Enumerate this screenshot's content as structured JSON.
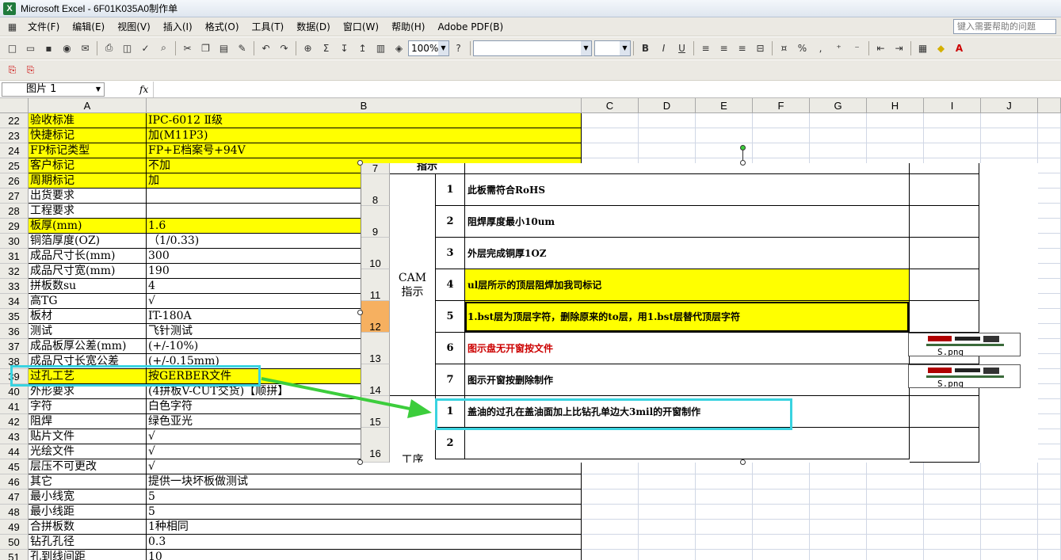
{
  "window": {
    "title": "Microsoft Excel - 6F01K035A0制作单",
    "app_icon": "X"
  },
  "menu": [
    "文件(F)",
    "编辑(E)",
    "视图(V)",
    "插入(I)",
    "格式(O)",
    "工具(T)",
    "数据(D)",
    "窗口(W)",
    "帮助(H)",
    "Adobe PDF(B)"
  ],
  "help_search": {
    "placeholder": "键入需要帮助的问题"
  },
  "toolbar": {
    "zoom": "100%"
  },
  "formula_bar": {
    "name_box": "图片 1",
    "fx": "fx",
    "formula": ""
  },
  "columns": [
    "A",
    "B",
    "C",
    "D",
    "E",
    "F",
    "G",
    "H",
    "I",
    "J"
  ],
  "rows": [
    {
      "num": "22",
      "a": "验收标准",
      "b": "IPC-6012 Ⅱ级",
      "yellow": true
    },
    {
      "num": "23",
      "a": "快捷标记",
      "b": "加(M11P3)",
      "yellow": true
    },
    {
      "num": "24",
      "a": "FP标记类型",
      "b": "FP+E档案号+94V",
      "yellow": true
    },
    {
      "num": "25",
      "a": "客户标记",
      "b": "不加",
      "yellow": true
    },
    {
      "num": "26",
      "a": "周期标记",
      "b": "加",
      "yellow": true
    },
    {
      "num": "27",
      "a": "出货要求",
      "b": "",
      "yellow": false
    },
    {
      "num": "28",
      "a": "工程要求",
      "b": "",
      "yellow": false
    },
    {
      "num": "29",
      "a": "板厚(mm)",
      "b": "1.6",
      "yellow": true
    },
    {
      "num": "30",
      "a": "铜箔厚度(OZ)",
      "b": "（1/0.33)",
      "yellow": false
    },
    {
      "num": "31",
      "a": "成品尺寸长(mm)",
      "b": "300",
      "yellow": false
    },
    {
      "num": "32",
      "a": "成品尺寸宽(mm)",
      "b": "190",
      "yellow": false
    },
    {
      "num": "33",
      "a": "拼板数su",
      "b": "4",
      "yellow": false
    },
    {
      "num": "34",
      "a": "高TG",
      "b": "√",
      "yellow": false
    },
    {
      "num": "35",
      "a": "板材",
      "b": "IT-180A",
      "yellow": false
    },
    {
      "num": "36",
      "a": "测试",
      "b": "飞针测试",
      "yellow": false
    },
    {
      "num": "37",
      "a": "成品板厚公差(mm)",
      "b": "(+/-10%)",
      "yellow": false
    },
    {
      "num": "38",
      "a": "成品尺寸长宽公差",
      "b": "(+/-0.15mm)",
      "yellow": false
    },
    {
      "num": "39",
      "a": "过孔工艺",
      "b": "按GERBER文件",
      "yellow": true
    },
    {
      "num": "40",
      "a": "外形要求",
      "b": "(4拼板V-CUT交货)【顺拼】",
      "yellow": false
    },
    {
      "num": "41",
      "a": "字符",
      "b": "白色字符",
      "yellow": false
    },
    {
      "num": "42",
      "a": "阻焊",
      "b": "绿色亚光",
      "yellow": false
    },
    {
      "num": "43",
      "a": "贴片文件",
      "b": "√",
      "yellow": false
    },
    {
      "num": "44",
      "a": "光绘文件",
      "b": "√",
      "yellow": false
    },
    {
      "num": "45",
      "a": "层压不可更改",
      "b": "√",
      "yellow": false
    },
    {
      "num": "46",
      "a": "其它",
      "b": "提供一块坏板做测试",
      "yellow": false
    },
    {
      "num": "47",
      "a": "最小线宽",
      "b": "5",
      "yellow": false
    },
    {
      "num": "48",
      "a": "最小线距",
      "b": "5",
      "yellow": false
    },
    {
      "num": "49",
      "a": "合拼板数",
      "b": "1种相同",
      "yellow": false
    },
    {
      "num": "50",
      "a": "钻孔孔径",
      "b": "0.3",
      "yellow": false
    },
    {
      "num": "51",
      "a": "孔到线间距",
      "b": "10",
      "yellow": false
    }
  ],
  "picture": {
    "top_label": "指示",
    "cam_label": "CAM\n指示",
    "bottom_label": "工序",
    "rownums": [
      "7",
      "8",
      "9",
      "10",
      "11",
      "12",
      "13",
      "14",
      "15",
      "16"
    ],
    "items": [
      {
        "num": "1",
        "text": "此板需符合RoHS",
        "style": "plain"
      },
      {
        "num": "2",
        "text": "阻焊厚度最小10um",
        "style": "plain"
      },
      {
        "num": "3",
        "text": "外层完成铜厚1OZ",
        "style": "plain"
      },
      {
        "num": "4",
        "text": "ul层所示的顶层阻焊加我司标记",
        "style": "yellow"
      },
      {
        "num": "5",
        "text": "1.bst层为顶层字符，删除原来的to层，用1.bst层替代顶层字符",
        "style": "yellow"
      },
      {
        "num": "6",
        "text": "图示盘无开窗按文件",
        "style": "red"
      },
      {
        "num": "7",
        "text": "图示开窗按删除制作",
        "style": "plain"
      },
      {
        "num": "1",
        "text": "盖油的过孔在盖油面加上比钻孔单边大3mil的开窗制作",
        "style": "plain"
      },
      {
        "num": "2",
        "text": "",
        "style": "plain"
      }
    ],
    "thumb_caption": "S.png"
  },
  "colors": {
    "yellow": "#ffff00",
    "highlight": "#39d3e0",
    "arrow": "#3ccd3c",
    "red_text": "#cc0000"
  }
}
